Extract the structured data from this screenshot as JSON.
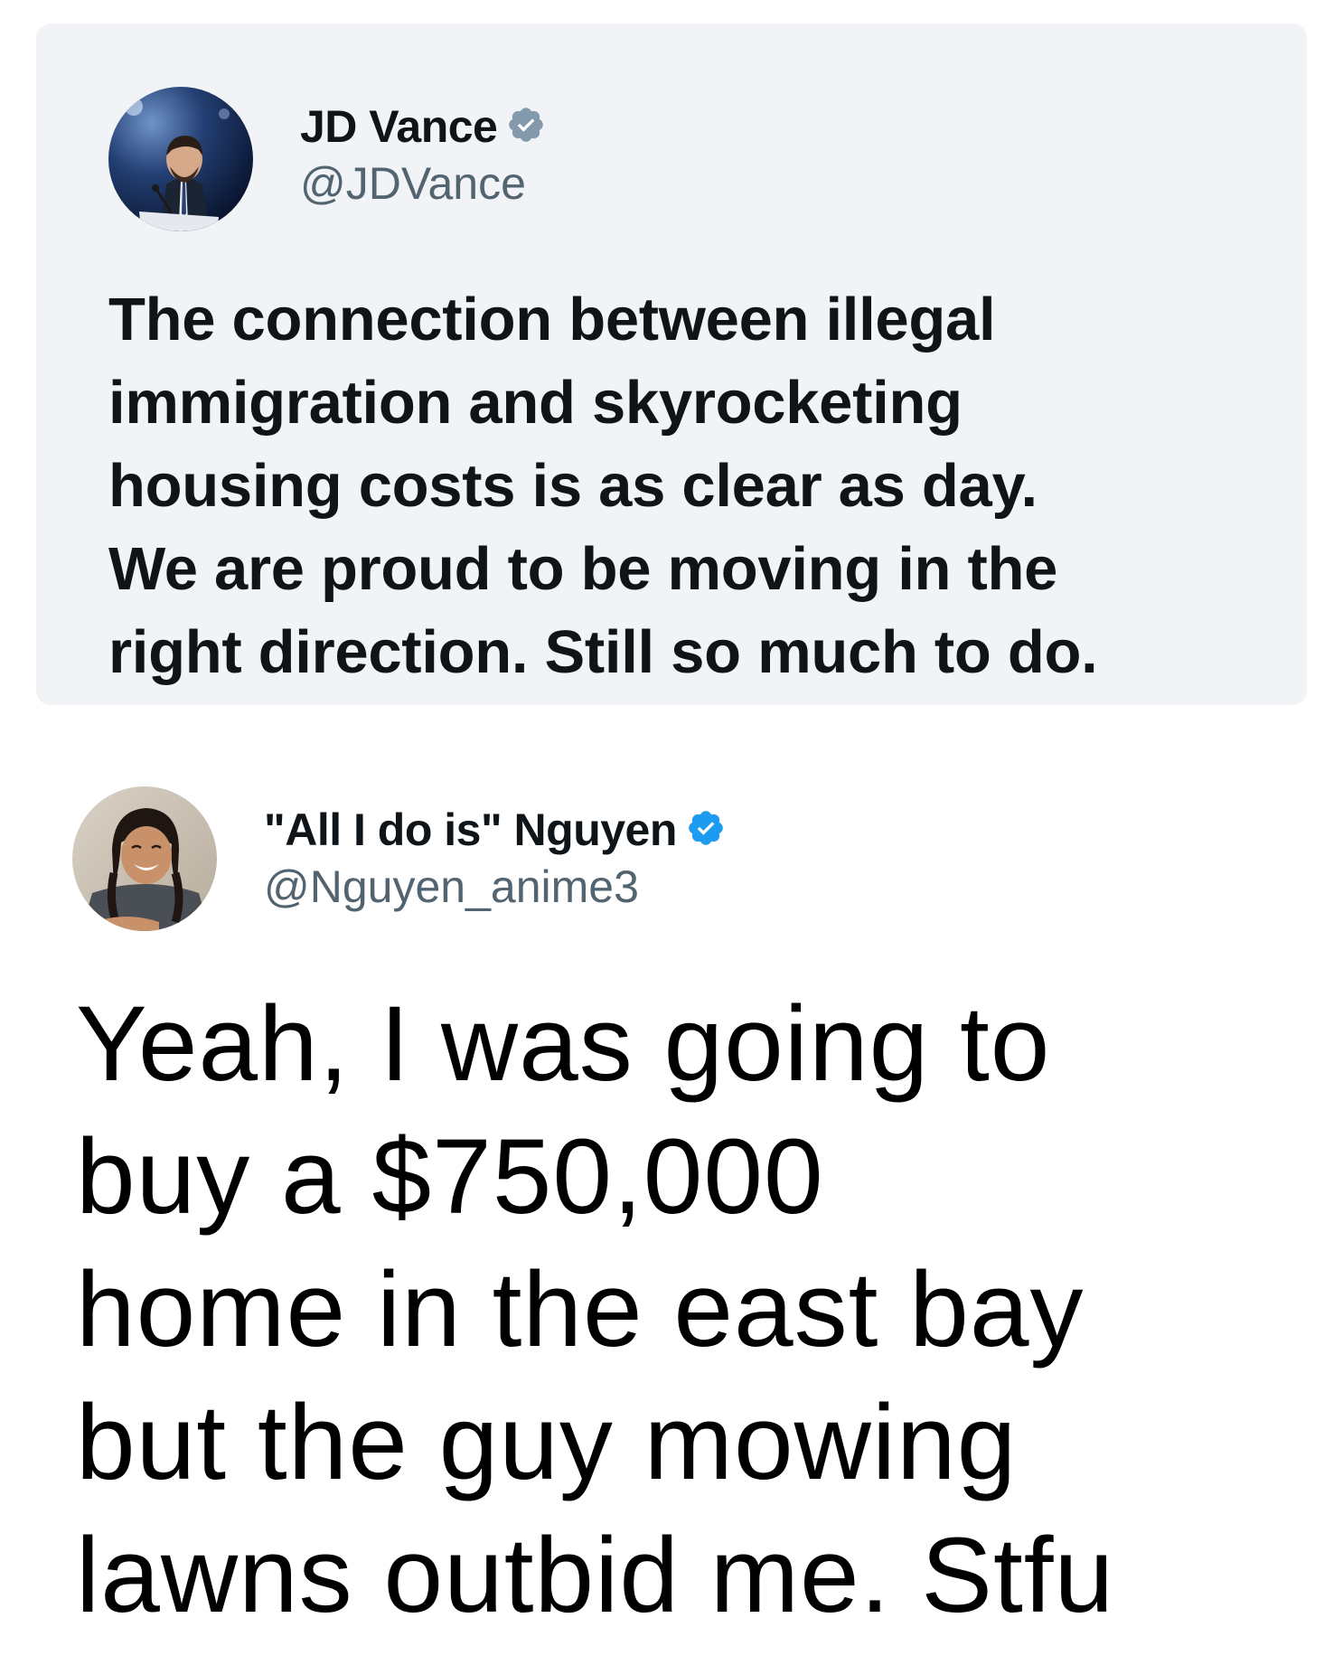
{
  "quoted_tweet": {
    "author_name": "JD Vance",
    "handle": "@JDVance",
    "verified": true,
    "verified_badge_color": "#829aab",
    "avatar_icon": "profile-photo-speaker-at-podium",
    "text": "The connection between illegal\nimmigration and skyrocketing\nhousing costs is as clear as day.\nWe are proud to be moving in the\nright direction. Still so much to do.",
    "card_background": "#f1f3f6"
  },
  "reply_tweet": {
    "author_name": "\"All I do is\" Nguyen",
    "handle": "@Nguyen_anime3",
    "verified": true,
    "verified_badge_color": "#1d9bf0",
    "avatar_icon": "profile-photo-smiling-person",
    "text": "Yeah, I was going to\nbuy a $750,000\nhome in the east bay\nbut the guy mowing\nlawns outbid me. Stfu"
  },
  "colors": {
    "primary_text": "#0f1419",
    "secondary_text": "#536471"
  }
}
